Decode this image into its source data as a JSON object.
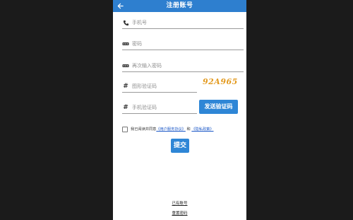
{
  "header": {
    "title": "注册账号",
    "back_icon": "arrow-left-icon"
  },
  "form": {
    "phone": {
      "placeholder": "手机号",
      "icon": "phone-icon"
    },
    "password": {
      "placeholder": "密码",
      "icon": "password-dots-icon"
    },
    "password_confirm": {
      "placeholder": "再次输入密码",
      "icon": "password-dots-icon"
    },
    "image_code": {
      "placeholder": "图形验证码",
      "icon": "hash-icon",
      "captcha_text": "92A965"
    },
    "sms_code": {
      "placeholder": "手机验证码",
      "icon": "hash-icon",
      "send_button": "发送验证码"
    }
  },
  "agreement": {
    "prefix": "我已阅读并同意",
    "user_agreement": "《用户服务协议》",
    "and": "和",
    "privacy": "《隐私政策》"
  },
  "submit_label": "提交",
  "links": {
    "have_account": "已有账号",
    "reset_password": "重置密码"
  },
  "colors": {
    "primary": "#2e86d6",
    "captcha": "#e39a1f",
    "link": "#1a57c7"
  }
}
